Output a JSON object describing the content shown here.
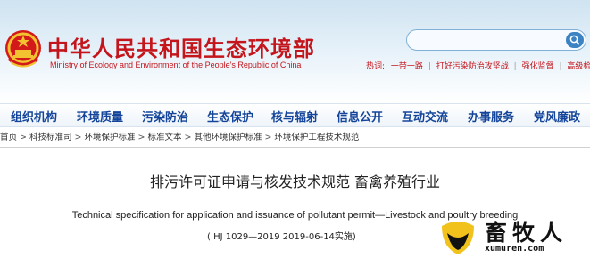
{
  "header": {
    "title_cn": "中华人民共和国生态环境部",
    "title_en": "Ministry of Ecology and Environment of the People's Republic of China",
    "search": {
      "placeholder": ""
    },
    "hot": {
      "label": "热词:",
      "links": [
        "一带一路",
        "打好污染防治攻坚战",
        "强化监督",
        "高级检索"
      ]
    }
  },
  "nav": {
    "items": [
      "组织机构",
      "环境质量",
      "污染防治",
      "生态保护",
      "核与辐射",
      "信息公开",
      "互动交流",
      "办事服务",
      "党风廉政"
    ]
  },
  "breadcrumb": [
    "首页",
    "科技标准司",
    "环境保护标准",
    "标准文本",
    "其他环境保护标准",
    "环境保护工程技术规范"
  ],
  "article": {
    "title": "排污许可证申请与核发技术规范 畜禽养殖行业",
    "title_en": "Technical specification for application and issuance of pollutant permit—Livestock and poultry breeding",
    "standard_info": "( HJ 1029—2019 2019-06-14实施)"
  },
  "watermark": {
    "brand": "畜牧人",
    "url": "xumuren.com"
  },
  "colors": {
    "brand_red": "#c4151c",
    "nav_blue": "#14459a",
    "header_bg": "#d8e8f4"
  }
}
